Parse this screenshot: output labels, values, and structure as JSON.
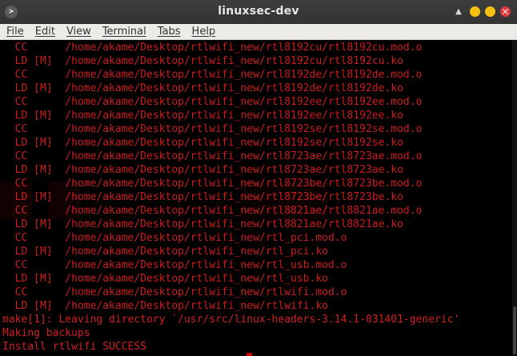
{
  "window": {
    "title": "linuxsec-dev",
    "app_icon_glyph": ">",
    "controls": {
      "up_arrow": "▲"
    }
  },
  "menubar": {
    "items": [
      {
        "label": "File"
      },
      {
        "label": "Edit"
      },
      {
        "label": "View"
      },
      {
        "label": "Terminal"
      },
      {
        "label": "Tabs"
      },
      {
        "label": "Help"
      }
    ]
  },
  "terminal": {
    "lines": [
      "  CC      /home/akame/Desktop/rtlwifi_new/rtl8192cu/rtl8192cu.mod.o",
      "  LD [M]  /home/akame/Desktop/rtlwifi_new/rtl8192cu/rtl8192cu.ko",
      "  CC      /home/akame/Desktop/rtlwifi_new/rtl8192de/rtl8192de.mod.o",
      "  LD [M]  /home/akame/Desktop/rtlwifi_new/rtl8192de/rtl8192de.ko",
      "  CC      /home/akame/Desktop/rtlwifi_new/rtl8192ee/rtl8192ee.mod.o",
      "  LD [M]  /home/akame/Desktop/rtlwifi_new/rtl8192ee/rtl8192ee.ko",
      "  CC      /home/akame/Desktop/rtlwifi_new/rtl8192se/rtl8192se.mod.o",
      "  LD [M]  /home/akame/Desktop/rtlwifi_new/rtl8192se/rtl8192se.ko",
      "  CC      /home/akame/Desktop/rtlwifi_new/rtl8723ae/rtl8723ae.mod.o",
      "  LD [M]  /home/akame/Desktop/rtlwifi_new/rtl8723ae/rtl8723ae.ko",
      "  CC      /home/akame/Desktop/rtlwifi_new/rtl8723be/rtl8723be.mod.o",
      "  LD [M]  /home/akame/Desktop/rtlwifi_new/rtl8723be/rtl8723be.ko",
      "  CC      /home/akame/Desktop/rtlwifi_new/rtl8821ae/rtl8821ae.mod.o",
      "  LD [M]  /home/akame/Desktop/rtlwifi_new/rtl8821ae/rtl8821ae.ko",
      "  CC      /home/akame/Desktop/rtlwifi_new/rtl_pci.mod.o",
      "  LD [M]  /home/akame/Desktop/rtlwifi_new/rtl_pci.ko",
      "  CC      /home/akame/Desktop/rtlwifi_new/rtl_usb.mod.o",
      "  LD [M]  /home/akame/Desktop/rtlwifi_new/rtl_usb.ko",
      "  CC      /home/akame/Desktop/rtlwifi_new/rtlwifi.mod.o",
      "  LD [M]  /home/akame/Desktop/rtlwifi_new/rtlwifi.ko",
      "make[1]: Leaving directory `/usr/src/linux-headers-3.14.1-031401-generic'",
      "Making backups",
      "Install rtlwifi SUCCESS"
    ]
  },
  "colors": {
    "terminal_bg": "#000000",
    "terminal_fg": "#cc1d1d",
    "titlebar_bg": "#3a3a3a",
    "menubar_bg": "#ecebe8",
    "close_button": "#e0393e",
    "min_max_button": "#f5c211"
  }
}
